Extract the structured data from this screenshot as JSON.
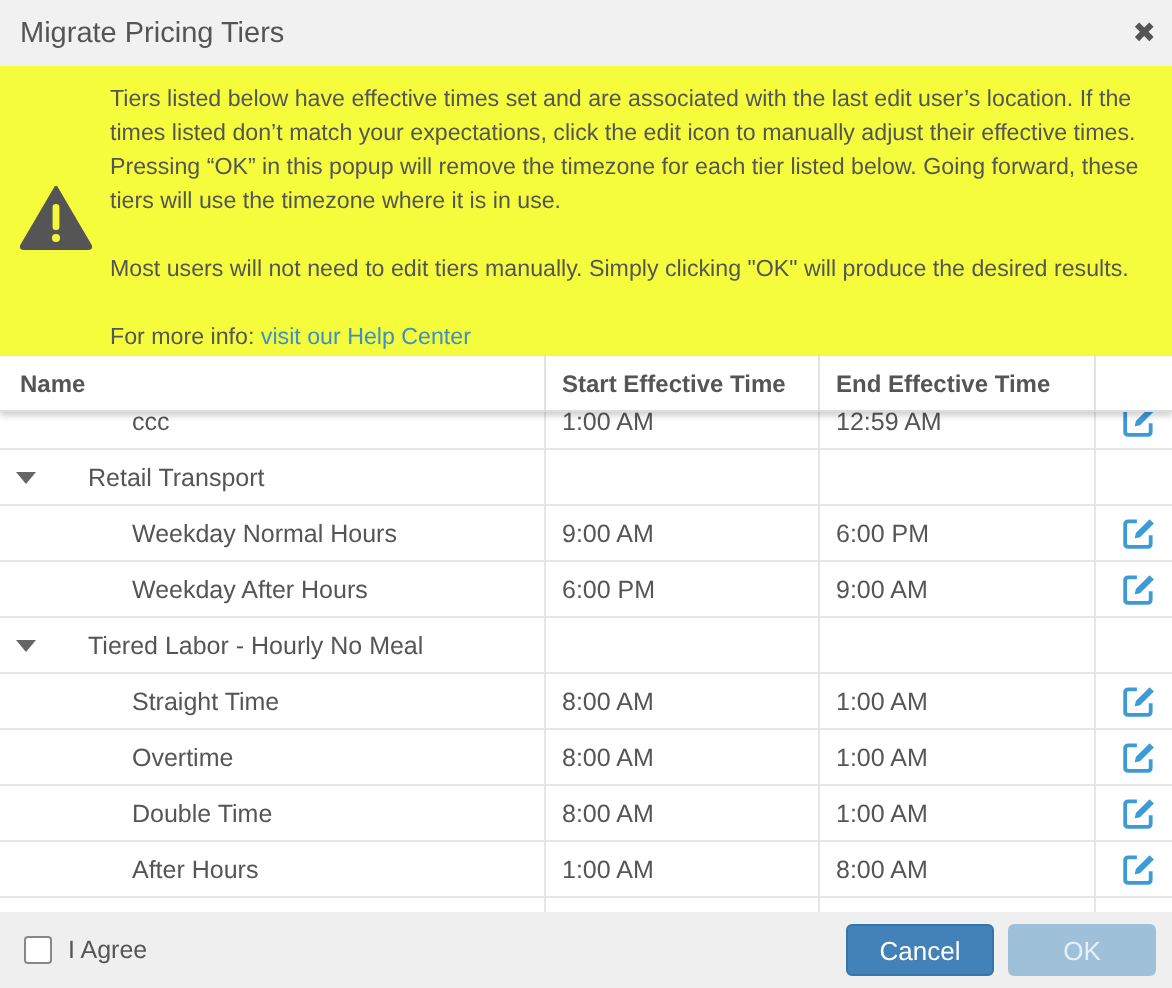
{
  "window": {
    "title": "Migrate Pricing Tiers",
    "close": "✖"
  },
  "notice": {
    "paragraphs": [
      "Tiers listed below have effective times set and are associated with the last edit user’s location. If the times listed don’t match your expectations, click the edit icon to manually adjust their effective times. Pressing “OK” in this popup will remove the timezone for each tier listed below. Going forward, these tiers will use the timezone where it is in use.",
      "Most users will not need to edit tiers manually. Simply clicking \"OK\" will produce the desired results."
    ],
    "info_label": "For more info:",
    "link": "visit our Help Center"
  },
  "table": {
    "columns": [
      "Name",
      "Start Effective Time",
      "End Effective Time"
    ],
    "rows": [
      {
        "kind": "tier",
        "name": "ccc",
        "start": "1:00 AM",
        "end": "12:59 AM"
      },
      {
        "kind": "group",
        "name": "Retail Transport",
        "expanded": true,
        "children": [
          {
            "kind": "tier",
            "name": "Weekday Normal Hours",
            "start": "9:00 AM",
            "end": "6:00 PM"
          },
          {
            "kind": "tier",
            "name": "Weekday After Hours",
            "start": "6:00 PM",
            "end": "9:00 AM"
          }
        ]
      },
      {
        "kind": "group",
        "name": "Tiered Labor - Hourly No Meal",
        "expanded": true,
        "children": [
          {
            "kind": "tier",
            "name": "Straight Time",
            "start": "8:00 AM",
            "end": "1:00 AM"
          },
          {
            "kind": "tier",
            "name": "Overtime",
            "start": "8:00 AM",
            "end": "1:00 AM"
          },
          {
            "kind": "tier",
            "name": "Double Time",
            "start": "8:00 AM",
            "end": "1:00 AM"
          },
          {
            "kind": "tier",
            "name": "After Hours",
            "start": "1:00 AM",
            "end": "8:00 AM"
          }
        ]
      }
    ]
  },
  "footer": {
    "agree": {
      "label": "I Agree",
      "checked": false
    },
    "buttons": [
      {
        "label": "Cancel",
        "disabled": false
      },
      {
        "label": "OK",
        "disabled": true
      }
    ]
  }
}
